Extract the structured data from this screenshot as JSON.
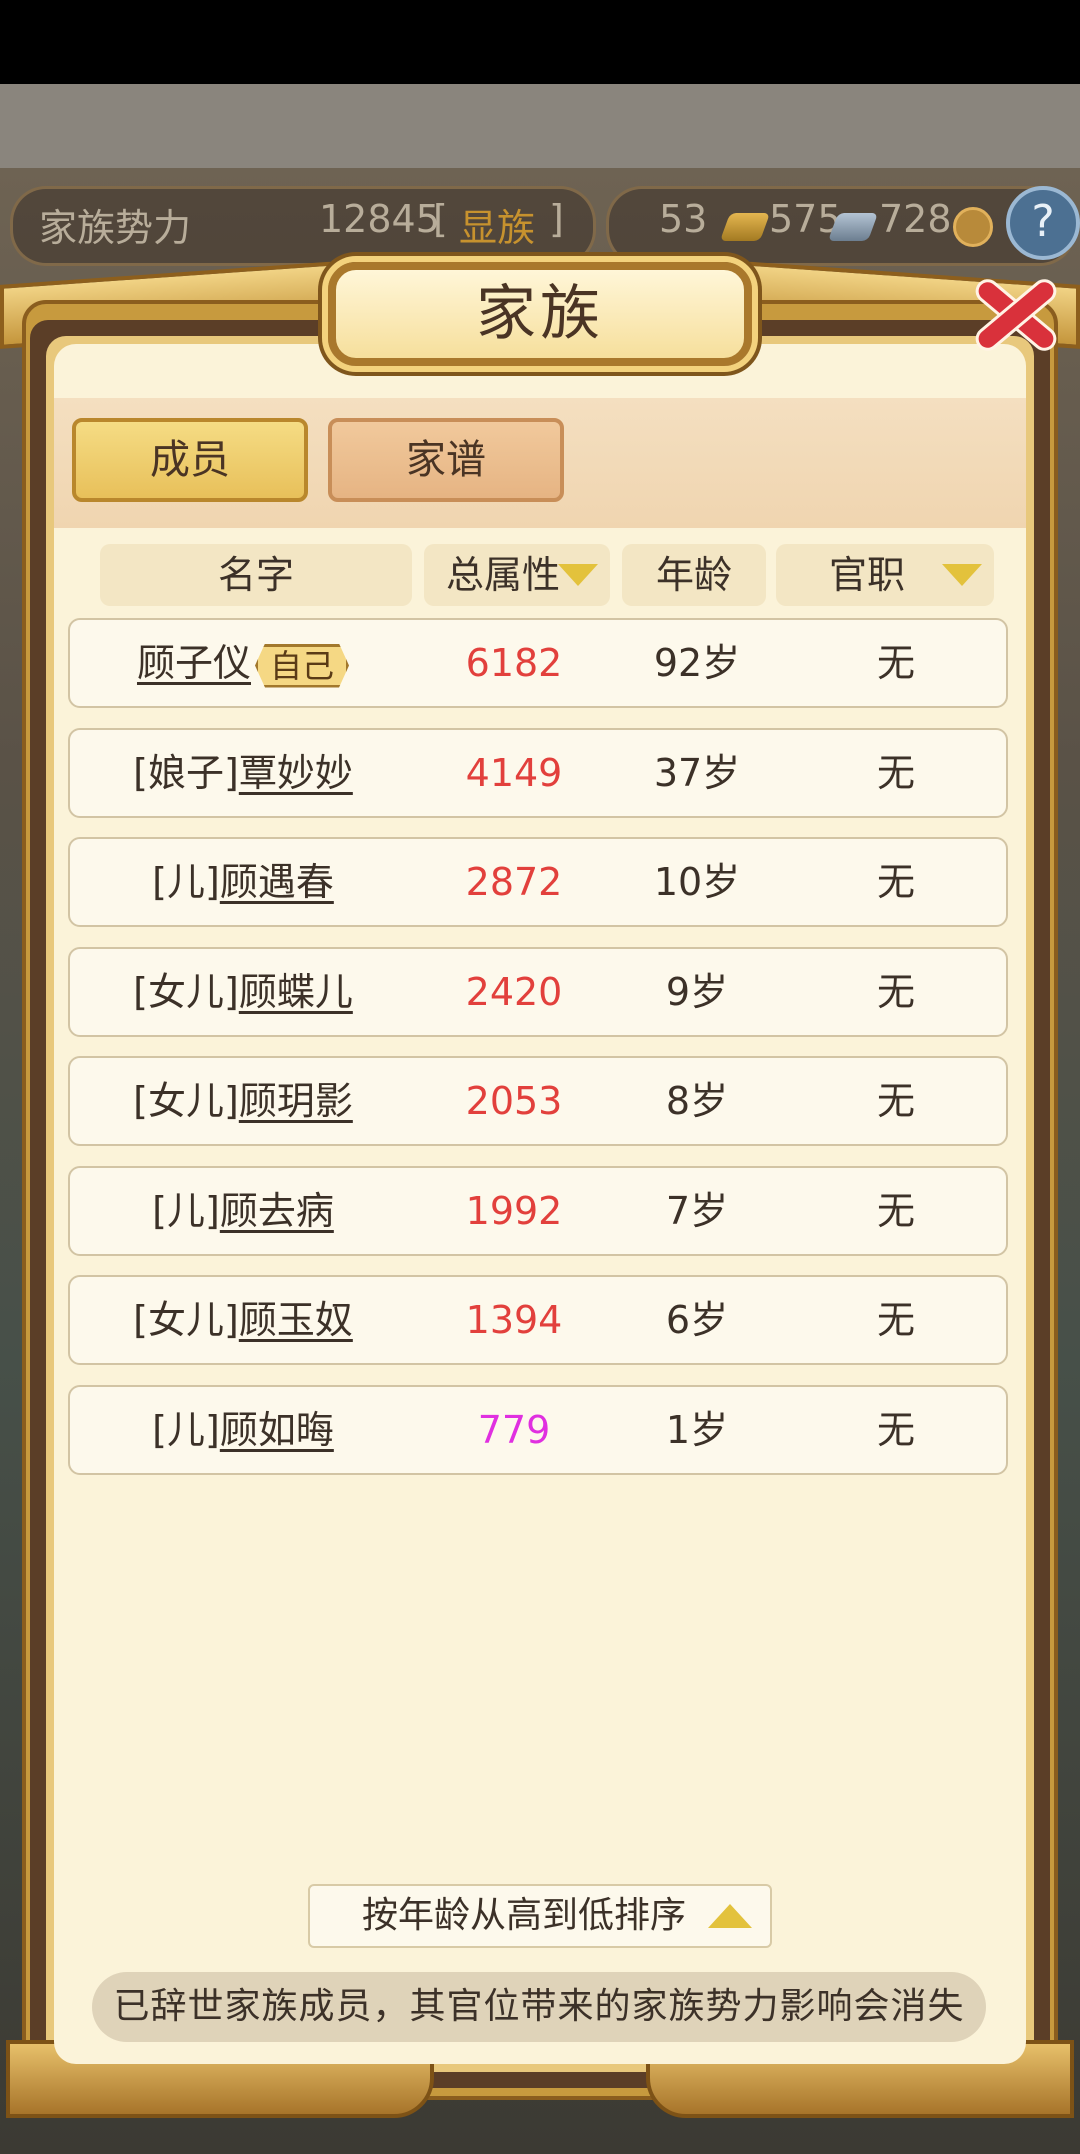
{
  "resources": {
    "influence_label": "家族势力",
    "influence_value": "12845",
    "bracket_open": "[",
    "rank": "显族",
    "bracket_close": "]",
    "gold": "53",
    "silver": "575",
    "coins": "728",
    "help_symbol": "?"
  },
  "panel": {
    "title": "家族",
    "close_symbol": "close"
  },
  "tabs": [
    {
      "label": "成员",
      "active": true
    },
    {
      "label": "家谱",
      "active": false
    }
  ],
  "table": {
    "headers": {
      "name": "名字",
      "attr": "总属性",
      "age": "年龄",
      "post": "官职"
    },
    "self_badge": "自己",
    "rows": [
      {
        "prefix": "",
        "name": "顾子仪",
        "attr": "6182",
        "age": "92岁",
        "post": "无",
        "attr_color": "#e2403c",
        "is_self": true
      },
      {
        "prefix": "[娘子]",
        "name": "覃妙妙",
        "attr": "4149",
        "age": "37岁",
        "post": "无",
        "attr_color": "#e2403c"
      },
      {
        "prefix": "[儿]",
        "name": "顾遇春",
        "attr": "2872",
        "age": "10岁",
        "post": "无",
        "attr_color": "#e2403c"
      },
      {
        "prefix": "[女儿]",
        "name": "顾蝶儿",
        "attr": "2420",
        "age": "9岁",
        "post": "无",
        "attr_color": "#e2403c"
      },
      {
        "prefix": "[女儿]",
        "name": "顾玥影",
        "attr": "2053",
        "age": "8岁",
        "post": "无",
        "attr_color": "#e2403c"
      },
      {
        "prefix": "[儿]",
        "name": "顾去病",
        "attr": "1992",
        "age": "7岁",
        "post": "无",
        "attr_color": "#e2403c"
      },
      {
        "prefix": "[女儿]",
        "name": "顾玉奴",
        "attr": "1394",
        "age": "6岁",
        "post": "无",
        "attr_color": "#e2403c"
      },
      {
        "prefix": "[儿]",
        "name": "顾如晦",
        "attr": "779",
        "age": "1岁",
        "post": "无",
        "attr_color": "#e030e0"
      }
    ]
  },
  "sort_button": "按年龄从高到低排序",
  "notice": "已辞世家族成员，其官位带来的家族势力影响会消失"
}
